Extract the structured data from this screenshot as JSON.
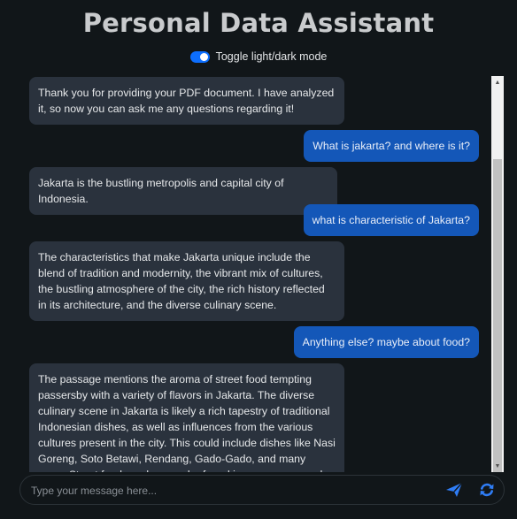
{
  "app": {
    "title": "Personal Data Assistant"
  },
  "theme_toggle": {
    "label": "Toggle light/dark mode",
    "checked": true
  },
  "messages": [
    {
      "role": "assistant",
      "text": "Thank you for providing your PDF document. I have analyzed it, so now you can ask me any questions regarding it!"
    },
    {
      "role": "user",
      "text": "What is jakarta? and where is it?"
    },
    {
      "role": "assistant",
      "text": "Jakarta is the bustling metropolis and capital city of Indonesia."
    },
    {
      "role": "user",
      "text": "what is characteristic of Jakarta?"
    },
    {
      "role": "assistant",
      "text": "The characteristics that make Jakarta unique include the blend of tradition and modernity, the vibrant mix of cultures, the bustling atmosphere of the city, the rich history reflected in its architecture, and the diverse culinary scene."
    },
    {
      "role": "user",
      "text": "Anything else? maybe about food?"
    },
    {
      "role": "assistant",
      "text": "The passage mentions the aroma of street food tempting passersby with a variety of flavors in Jakarta. The diverse culinary scene in Jakarta is likely a rich tapestry of traditional Indonesian dishes, as well as influences from the various cultures present in the city. This could include dishes like Nasi Goreng, Soto Betawi, Rendang, Gado-Gado, and many more. Street food vendors can be found in many areas and are a great way to experience the local food culture."
    }
  ],
  "composer": {
    "placeholder": "Type your message here...",
    "value": ""
  },
  "icons": {
    "send": "send-icon",
    "refresh": "refresh-icon"
  },
  "colors": {
    "accent": "#0d6efd",
    "user_bubble": "#1457b8",
    "bot_bubble": "#2a323d",
    "background": "#111619"
  }
}
